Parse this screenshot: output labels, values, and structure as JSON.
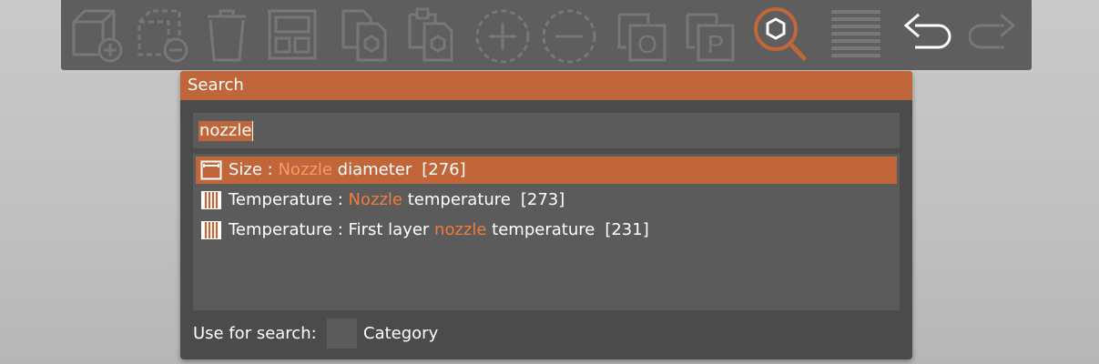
{
  "toolbar": {
    "buttons": [
      {
        "name": "add-object-button",
        "icon": "add-cube-icon",
        "active": false
      },
      {
        "name": "delete-object-button",
        "icon": "remove-cube-icon",
        "active": false
      },
      {
        "name": "delete-all-button",
        "icon": "trash-icon",
        "active": false
      },
      {
        "name": "arrange-button",
        "icon": "arrange-icon",
        "active": false
      },
      {
        "name": "copy-button",
        "icon": "copy-icon",
        "active": false
      },
      {
        "name": "paste-button",
        "icon": "paste-icon",
        "active": false
      },
      {
        "name": "add-instance-button",
        "icon": "plus-circle-icon",
        "active": false
      },
      {
        "name": "remove-instance-button",
        "icon": "minus-circle-icon",
        "active": false
      },
      {
        "name": "split-to-objects-button",
        "icon": "split-objects-icon",
        "active": false
      },
      {
        "name": "split-to-parts-button",
        "icon": "split-parts-icon",
        "active": false
      },
      {
        "name": "search-button",
        "icon": "search-icon",
        "active": true
      },
      {
        "name": "layers-editing-button",
        "icon": "layers-icon",
        "active": false
      },
      {
        "name": "undo-button",
        "icon": "undo-icon",
        "active": false
      },
      {
        "name": "redo-button",
        "icon": "redo-icon",
        "active": false
      }
    ],
    "split_objects_letter": "O",
    "split_parts_letter": "P"
  },
  "dialog": {
    "title": "Search",
    "query": "nozzle",
    "results": [
      {
        "icon": "size-icon",
        "category": "Size",
        "separator": " : ",
        "pre": "",
        "match": "Nozzle",
        "post": " diameter",
        "count": "[276]",
        "selected": true
      },
      {
        "icon": "temperature-icon",
        "category": "Temperature",
        "separator": " : ",
        "pre": "",
        "match": "Nozzle",
        "post": " temperature",
        "count": "[273]",
        "selected": false
      },
      {
        "icon": "temperature-icon",
        "category": "Temperature",
        "separator": " : ",
        "pre": "First layer ",
        "match": "nozzle",
        "post": " temperature",
        "count": "[231]",
        "selected": false
      }
    ],
    "footer": {
      "use_for_search_label": "Use for search:",
      "category_label": "Category",
      "category_checked": false
    }
  },
  "colors": {
    "accent": "#c1653a",
    "highlight_text": "#f07b3c",
    "toolbar_bg": "#5e5e5e",
    "dialog_bg": "#4b4b4b",
    "field_bg": "#5b5b5b",
    "icon_gray": "#777777"
  }
}
